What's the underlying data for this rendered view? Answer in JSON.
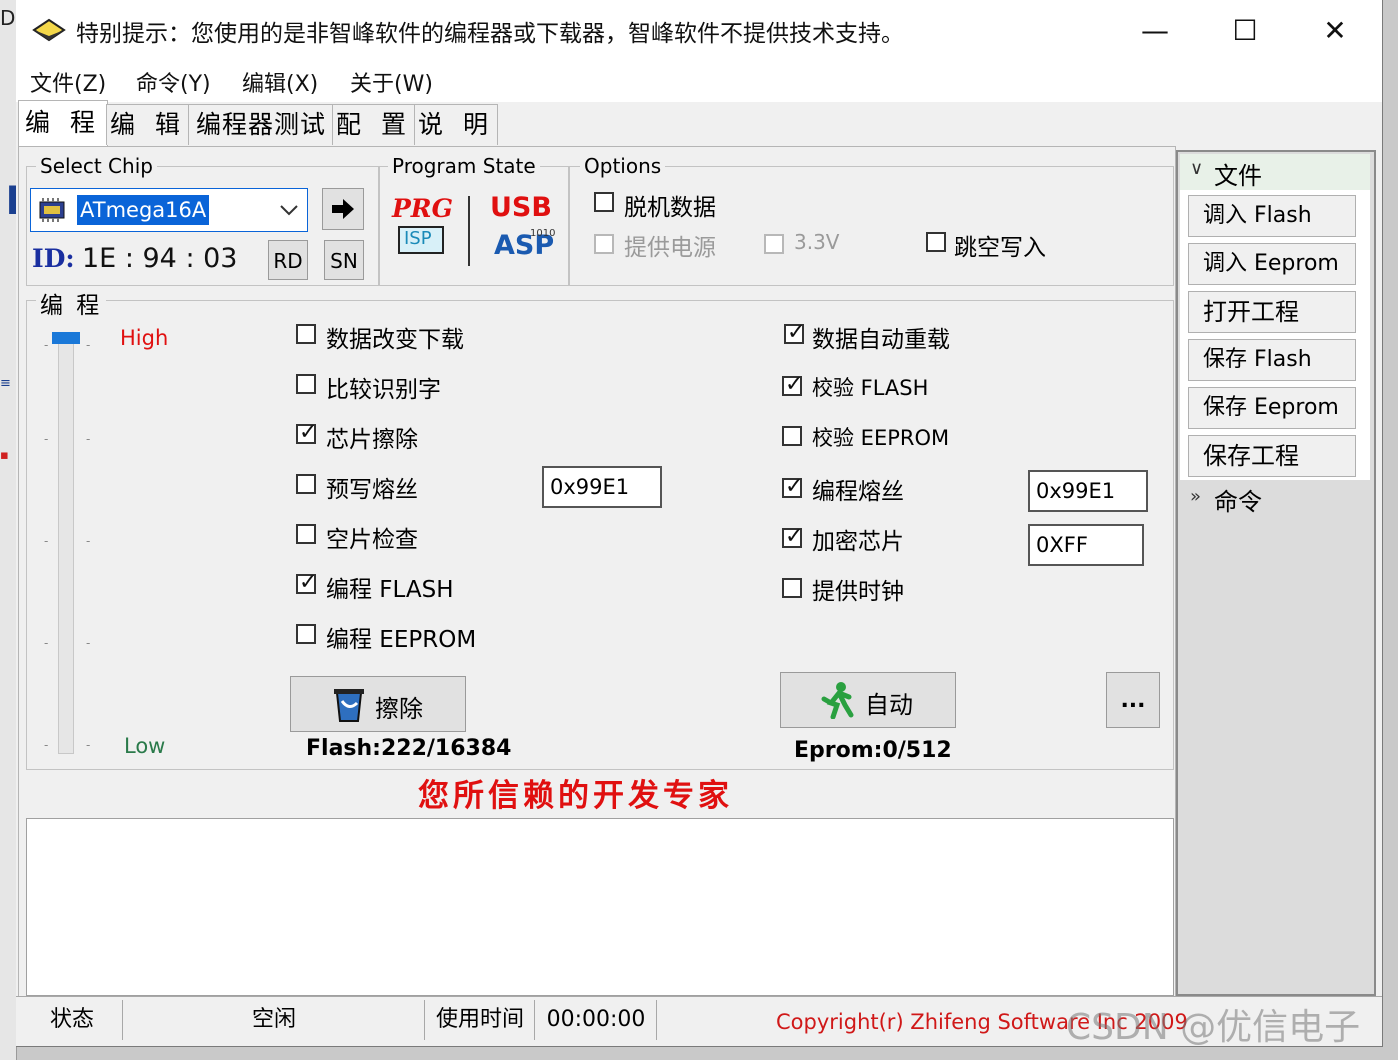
{
  "title": "特别提示：您使用的是非智峰软件的编程器或下载器，智峰软件不提供技术支持。",
  "window_controls": {
    "minimize": "—",
    "maximize": "☐",
    "close": "✕"
  },
  "menu": [
    "文件(Z)",
    "命令(Y)",
    "编辑(X)",
    "关于(W)"
  ],
  "tabs": [
    "编 程",
    "编 辑",
    "编程器测试",
    "配 置",
    "说 明"
  ],
  "select_chip": {
    "label": "Select Chip",
    "chip": "ATmega16A",
    "id_label": "ID:",
    "id_value": "1E : 94 : 03",
    "rd": "RD",
    "sn": "SN"
  },
  "program_state": {
    "label": "Program State",
    "prg": "PRG",
    "isp": "ISP",
    "usb": "USB",
    "asp": "ASP",
    "bits": "1010"
  },
  "options": {
    "label": "Options",
    "offline": "脱机数据",
    "power": "提供电源",
    "v33": "3.3V",
    "skip_blank": "跳空写入"
  },
  "program_group": {
    "label": "编 程",
    "high": "High",
    "low": "Low",
    "left_checks": [
      {
        "text": "数据改变下载",
        "checked": false
      },
      {
        "text": "比较识别字",
        "checked": false
      },
      {
        "text": "芯片擦除",
        "checked": true
      },
      {
        "text": "预写熔丝",
        "checked": false
      },
      {
        "text": "空片检查",
        "checked": false
      },
      {
        "text": "编程 FLASH",
        "checked": true
      },
      {
        "text": "编程 EEPROM",
        "checked": false
      }
    ],
    "right_checks": [
      {
        "text": "数据自动重载",
        "checked": true
      },
      {
        "text": "校验 FLASH",
        "checked": true
      },
      {
        "text": "校验 EEPROM",
        "checked": false
      },
      {
        "text": "编程熔丝",
        "checked": true
      },
      {
        "text": "加密芯片",
        "checked": true
      },
      {
        "text": "提供时钟",
        "checked": false
      }
    ],
    "prefuse_value": "0x99E1",
    "fuse_value": "0x99E1",
    "lock_value": "0XFF",
    "erase_btn": "擦除",
    "auto_btn": "自动",
    "more_btn": "...",
    "flash_info": "Flash:222/16384",
    "eeprom_info": "Eprom:0/512"
  },
  "slogan": "您所信赖的开发专家",
  "sidebar": {
    "file_header": "文件",
    "buttons": [
      "调入 Flash",
      "调入 Eeprom",
      "打开工程",
      "保存 Flash",
      "保存 Eeprom",
      "保存工程"
    ],
    "cmd_header": "命令"
  },
  "status": {
    "state_label": "状态",
    "state_value": "空闲",
    "time_label": "使用时间",
    "time_value": "00:00:00",
    "copyright": "Copyright(r) Zhifeng Software Inc 2009"
  },
  "watermark": "CSDN @优信电子",
  "colors": {
    "accent_red": "#e01010",
    "select_blue": "#0a64d8",
    "id_blue": "#1a2fa0",
    "low_green": "#2a7a4a"
  }
}
